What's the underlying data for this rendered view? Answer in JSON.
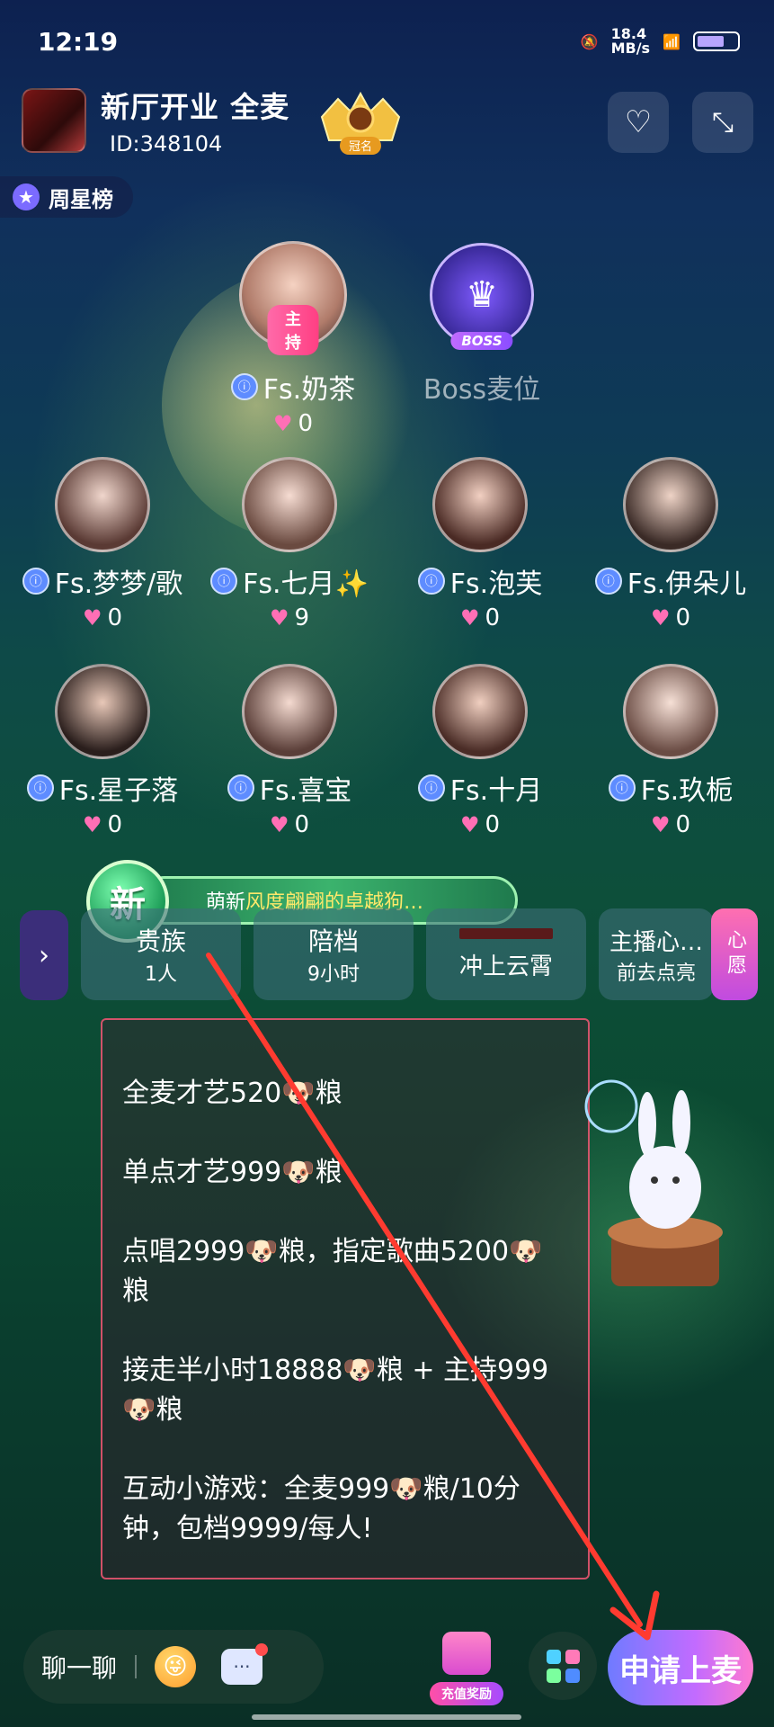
{
  "status_bar": {
    "time": "12:19",
    "speed": "18.4\nMB/s"
  },
  "header": {
    "room_title": "新厅开业 全麦",
    "room_id": "ID:348104",
    "crown_label": "冠名",
    "favorite_icon": "heart-plus-icon",
    "minimize_icon": "minimize-arrows-icon"
  },
  "weekly_star": {
    "label": "周星榜"
  },
  "host_seat": {
    "name": "Fs.奶茶",
    "tag": "主持",
    "score": "0"
  },
  "boss_seat": {
    "name": "Boss麦位",
    "tag": "BOSS"
  },
  "seats": [
    {
      "name": "Fs.梦梦/歌",
      "score": "0"
    },
    {
      "name": "Fs.七月✨",
      "score": "9"
    },
    {
      "name": "Fs.泡芙",
      "score": "0"
    },
    {
      "name": "Fs.伊朵儿",
      "score": "0"
    },
    {
      "name": "Fs.星子落",
      "score": "0"
    },
    {
      "name": "Fs.喜宝",
      "score": "0"
    },
    {
      "name": "Fs.十月",
      "score": "0"
    },
    {
      "name": "Fs.玖栀",
      "score": "0"
    }
  ],
  "banner": {
    "badge": "新",
    "prefix": "萌新",
    "text": "风度翩翩的卓越狗…"
  },
  "tabs": [
    {
      "title": "贵族",
      "sub": "1人"
    },
    {
      "title": "陪档",
      "sub": "9小时"
    },
    {
      "title": "",
      "sub": "冲上云霄"
    },
    {
      "title": "主播心…",
      "sub": "前去点亮"
    }
  ],
  "wish_label": "心愿",
  "announcement": [
    "全麦才艺520🐶粮",
    "单点才艺999🐶粮",
    "点唱2999🐶粮，指定歌曲5200🐶粮",
    "接走半小时18888🐶粮 + 主持999🐶粮",
    "互动小游戏：全麦999🐶粮/10分钟，包档9999/每人!"
  ],
  "bottom_bar": {
    "chat_label": "聊一聊",
    "gift_label": "充值奖励",
    "apply_label": "申请上麦"
  },
  "colors": {
    "accent": "#c26bff",
    "heart": "#ff6fb5",
    "arrow": "#ff3b30"
  }
}
